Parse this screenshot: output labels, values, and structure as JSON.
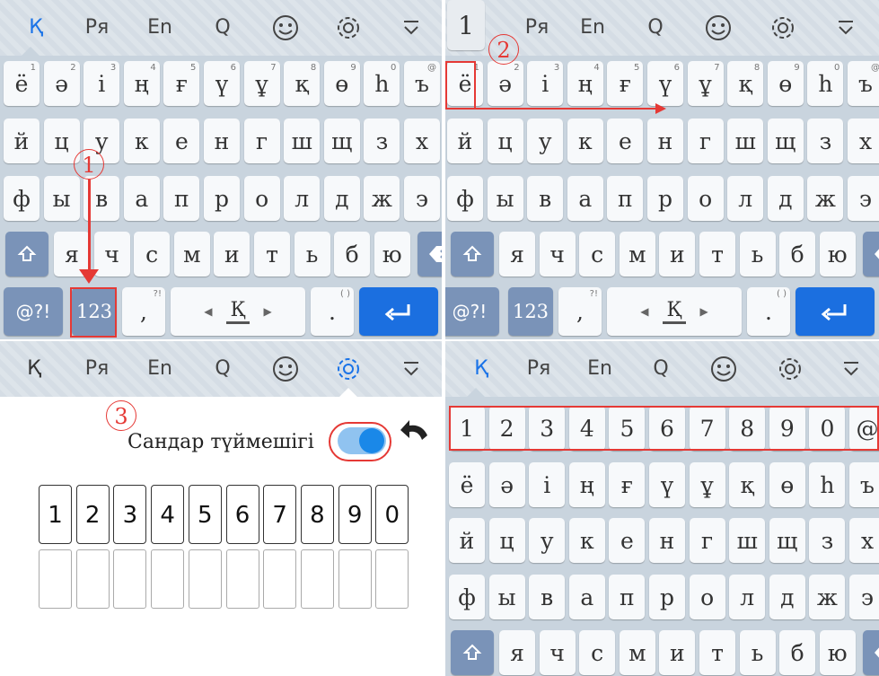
{
  "tabs": {
    "kazakh": "Қ",
    "russian": "Ря",
    "english": "En",
    "q": "Q"
  },
  "rows": {
    "r1": [
      "ё",
      "ә",
      "і",
      "ң",
      "ғ",
      "ү",
      "ұ",
      "қ",
      "ө",
      "һ",
      "ъ"
    ],
    "r1_hints": [
      "1",
      "2",
      "3",
      "4",
      "5",
      "6",
      "7",
      "8",
      "9",
      "0",
      "@"
    ],
    "r2": [
      "й",
      "ц",
      "у",
      "к",
      "е",
      "н",
      "г",
      "ш",
      "щ",
      "з",
      "х"
    ],
    "r3": [
      "ф",
      "ы",
      "в",
      "а",
      "п",
      "р",
      "о",
      "л",
      "д",
      "ж",
      "э"
    ],
    "r4": [
      "я",
      "ч",
      "с",
      "м",
      "и",
      "т",
      "ь",
      "б",
      "ю"
    ],
    "digits": [
      "1",
      "2",
      "3",
      "4",
      "5",
      "6",
      "7",
      "8",
      "9",
      "0",
      "@"
    ]
  },
  "bottom": {
    "symbols": "@?!",
    "numbers": "123",
    "comma": ",",
    "comma_hint": "?!",
    "space_lang": "Қ",
    "period": ".",
    "period_hint": "( )"
  },
  "annotations": {
    "step1": "1",
    "step2": "2",
    "step3": "3",
    "popup_digit": "1"
  },
  "settings": {
    "label": "Сандар түймешігі",
    "toggle_on": true,
    "digit_cells": [
      "1",
      "2",
      "3",
      "4",
      "5",
      "6",
      "7",
      "8",
      "9",
      "0"
    ]
  },
  "colors": {
    "accent": "#1a73e8",
    "annotation": "#e53935",
    "enter": "#1b6fe0",
    "function_key": "#7a93b8"
  }
}
